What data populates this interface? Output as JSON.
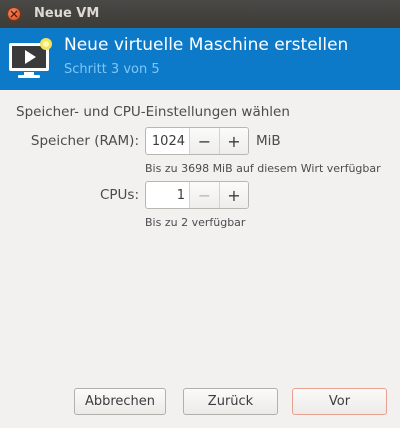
{
  "window": {
    "title": "Neue VM"
  },
  "banner": {
    "title": "Neue virtuelle Maschine erstellen",
    "subtitle": "Schritt 3 von 5"
  },
  "content": {
    "heading": "Speicher- und CPU-Einstellungen wählen",
    "memory": {
      "label": "Speicher (RAM):",
      "value": "1024",
      "unit": "MiB",
      "decrement": "−",
      "increment": "+",
      "hint": "Bis zu 3698 MiB auf diesem Wirt verfügbar"
    },
    "cpus": {
      "label": "CPUs:",
      "value": "1",
      "decrement": "−",
      "increment": "+",
      "hint": "Bis zu 2 verfügbar"
    }
  },
  "buttons": {
    "cancel": "Abbrechen",
    "back": "Zurück",
    "forward": "Vor"
  },
  "colors": {
    "banner": "#0d7ac9",
    "banner_subtitle": "#7fc6f5",
    "titlebar": "#3c3b37",
    "close": "#e05d2b"
  }
}
